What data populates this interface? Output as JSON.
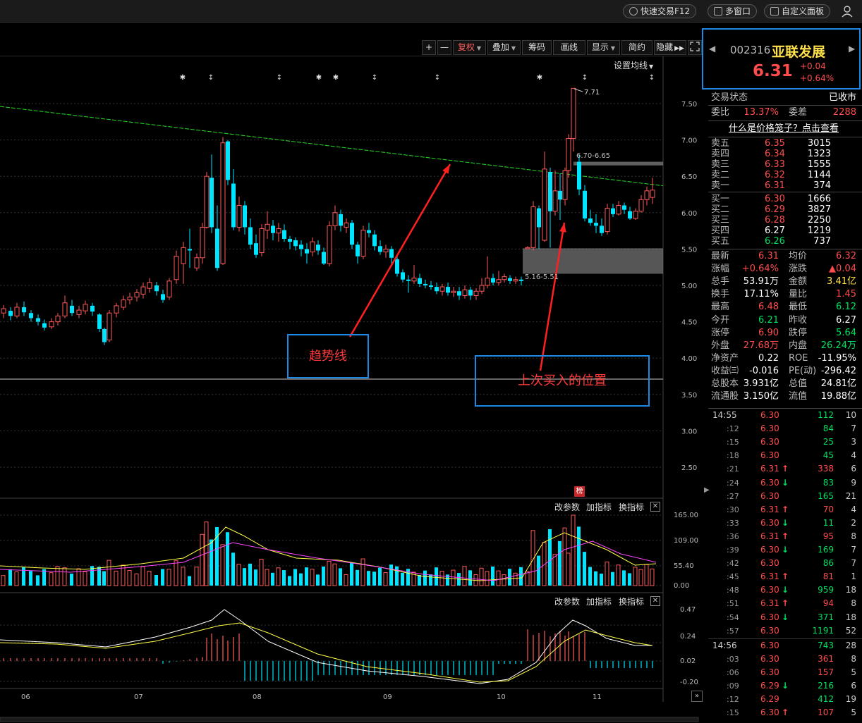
{
  "titlebar": {
    "quick_trade": "快速交易F12",
    "multi_window": "多窗口",
    "custom_panel": "自定义面板",
    "user_icon": "user-icon"
  },
  "toolbar": {
    "plus": "+",
    "minus": "—",
    "fuquan": "复权",
    "diejia": "叠加",
    "chouma": "筹码",
    "huaxian": "画线",
    "xianshi": "显示",
    "jianyue": "简约",
    "yincang": "隐藏",
    "expand_icon": "expand-icon"
  },
  "chart": {
    "setting_ma": "设置均线",
    "price_ticks": [
      "7.50",
      "7.00",
      "6.50",
      "6.00",
      "5.50",
      "5.00",
      "4.50",
      "4.00",
      "3.50",
      "3.00",
      "2.50"
    ],
    "vol_ticks": [
      "165.00",
      "109.00",
      "55.40",
      "0.00"
    ],
    "macd_ticks": [
      "0.47",
      "0.24",
      "0.02",
      "-0.20"
    ],
    "x_ticks": [
      "06",
      "07",
      "08",
      "09",
      "10",
      "11"
    ],
    "high_label": "7.71",
    "range_label_1": "6.70-6.65",
    "range_label_2": "5.16-5.51",
    "bang_badge": "榜",
    "sub1": {
      "change_param": "改参数",
      "add_indicator": "加指标",
      "switch_indicator": "换指标"
    },
    "sub2": {
      "change_param": "改参数",
      "add_indicator": "加指标",
      "switch_indicator": "换指标"
    },
    "annotation_trend": "趋势线",
    "annotation_buy": "上次买入的位置",
    "colors": {
      "up": "#ff5a5a",
      "down": "#00e5ff",
      "trend": "#22cc22",
      "ma_white": "#ffffff",
      "ma_yellow": "#ffff44",
      "ma_magenta": "#ff44ff",
      "arrow": "#ff2020"
    }
  },
  "quote": {
    "code": "002316",
    "name": "亚联发展",
    "price": "6.31",
    "change": "+0.04",
    "pct": "+0.64%"
  },
  "status": {
    "label": "交易状态",
    "value": "已收市"
  },
  "weibi": {
    "label": "委比",
    "value": "13.37%",
    "label2": "委差",
    "value2": "2288"
  },
  "cage_link": "什么是价格笼子？点击查看",
  "asks": [
    {
      "label": "卖五",
      "price": "6.35",
      "vol": "3015"
    },
    {
      "label": "卖四",
      "price": "6.34",
      "vol": "1323"
    },
    {
      "label": "卖三",
      "price": "6.33",
      "vol": "1555"
    },
    {
      "label": "卖二",
      "price": "6.32",
      "vol": "1144"
    },
    {
      "label": "卖一",
      "price": "6.31",
      "vol": "374"
    }
  ],
  "bids": [
    {
      "label": "买一",
      "price": "6.30",
      "vol": "1666"
    },
    {
      "label": "买二",
      "price": "6.29",
      "vol": "3827"
    },
    {
      "label": "买三",
      "price": "6.28",
      "vol": "2250"
    },
    {
      "label": "买四",
      "price": "6.27",
      "vol": "1219"
    },
    {
      "label": "买五",
      "price": "6.26",
      "vol": "737"
    }
  ],
  "stats": [
    {
      "l1": "最新",
      "v1": "6.31",
      "c1": "red",
      "l2": "均价",
      "v2": "6.32",
      "c2": "red"
    },
    {
      "l1": "涨幅",
      "v1": "+0.64%",
      "c1": "red",
      "l2": "涨跌",
      "v2": "▲0.04",
      "c2": "red"
    },
    {
      "l1": "总手",
      "v1": "53.91万",
      "c1": "white",
      "l2": "金额",
      "v2": "3.41亿",
      "c2": "yellow"
    },
    {
      "l1": "换手",
      "v1": "17.11%",
      "c1": "white",
      "l2": "量比",
      "v2": "1.45",
      "c2": "red"
    },
    {
      "l1": "最高",
      "v1": "6.48",
      "c1": "red",
      "l2": "最低",
      "v2": "6.12",
      "c2": "green"
    },
    {
      "l1": "今开",
      "v1": "6.21",
      "c1": "green",
      "l2": "昨收",
      "v2": "6.27",
      "c2": "white"
    },
    {
      "l1": "涨停",
      "v1": "6.90",
      "c1": "red",
      "l2": "跌停",
      "v2": "5.64",
      "c2": "green"
    },
    {
      "l1": "外盘",
      "v1": "27.68万",
      "c1": "red",
      "l2": "内盘",
      "v2": "26.24万",
      "c2": "green"
    },
    {
      "l1": "净资产",
      "v1": "0.22",
      "c1": "white",
      "l2": "ROE",
      "v2": "-11.95%",
      "c2": "white"
    },
    {
      "l1": "收益㈢",
      "v1": "-0.016",
      "c1": "white",
      "l2": "PE(动)",
      "v2": "-296.42",
      "c2": "white"
    },
    {
      "l1": "总股本",
      "v1": "3.931亿",
      "c1": "white",
      "l2": "总值",
      "v2": "24.81亿",
      "c2": "white"
    },
    {
      "l1": "流通股",
      "v1": "3.150亿",
      "c1": "white",
      "l2": "流值",
      "v2": "19.88亿",
      "c2": "white"
    }
  ],
  "ticks": [
    {
      "t": "14:55",
      "p": "6.30",
      "pc": "red",
      "a": "",
      "v": "112",
      "vc": "green",
      "c": "10"
    },
    {
      "t": ":12",
      "p": "6.30",
      "pc": "red",
      "a": "",
      "v": "84",
      "vc": "green",
      "c": "7"
    },
    {
      "t": ":15",
      "p": "6.30",
      "pc": "red",
      "a": "",
      "v": "25",
      "vc": "green",
      "c": "3"
    },
    {
      "t": ":18",
      "p": "6.30",
      "pc": "red",
      "a": "",
      "v": "45",
      "vc": "green",
      "c": "4"
    },
    {
      "t": ":21",
      "p": "6.31",
      "pc": "red",
      "a": "↑",
      "v": "338",
      "vc": "red",
      "c": "6"
    },
    {
      "t": ":24",
      "p": "6.30",
      "pc": "red",
      "a": "↓",
      "v": "83",
      "vc": "green",
      "c": "9"
    },
    {
      "t": ":27",
      "p": "6.30",
      "pc": "red",
      "a": "",
      "v": "165",
      "vc": "green",
      "c": "21"
    },
    {
      "t": ":30",
      "p": "6.31",
      "pc": "red",
      "a": "↑",
      "v": "70",
      "vc": "red",
      "c": "4"
    },
    {
      "t": ":33",
      "p": "6.30",
      "pc": "red",
      "a": "↓",
      "v": "11",
      "vc": "green",
      "c": "2"
    },
    {
      "t": ":36",
      "p": "6.31",
      "pc": "red",
      "a": "↑",
      "v": "95",
      "vc": "red",
      "c": "8"
    },
    {
      "t": ":39",
      "p": "6.30",
      "pc": "red",
      "a": "↓",
      "v": "169",
      "vc": "green",
      "c": "7"
    },
    {
      "t": ":42",
      "p": "6.30",
      "pc": "red",
      "a": "",
      "v": "86",
      "vc": "green",
      "c": "7"
    },
    {
      "t": ":45",
      "p": "6.31",
      "pc": "red",
      "a": "↑",
      "v": "81",
      "vc": "red",
      "c": "1"
    },
    {
      "t": ":48",
      "p": "6.30",
      "pc": "red",
      "a": "↓",
      "v": "959",
      "vc": "green",
      "c": "18"
    },
    {
      "t": ":51",
      "p": "6.31",
      "pc": "red",
      "a": "↑",
      "v": "94",
      "vc": "red",
      "c": "8"
    },
    {
      "t": ":54",
      "p": "6.30",
      "pc": "red",
      "a": "↓",
      "v": "371",
      "vc": "green",
      "c": "18"
    },
    {
      "t": ":57",
      "p": "6.30",
      "pc": "red",
      "a": "",
      "v": "1191",
      "vc": "green",
      "c": "52"
    },
    {
      "t": "14:56",
      "p": "6.30",
      "pc": "red",
      "a": "",
      "v": "743",
      "vc": "green",
      "c": "28"
    },
    {
      "t": ":03",
      "p": "6.30",
      "pc": "red",
      "a": "",
      "v": "361",
      "vc": "red",
      "c": "8"
    },
    {
      "t": ":06",
      "p": "6.30",
      "pc": "red",
      "a": "",
      "v": "157",
      "vc": "red",
      "c": "5"
    },
    {
      "t": ":09",
      "p": "6.29",
      "pc": "red",
      "a": "↓",
      "v": "216",
      "vc": "green",
      "c": "6"
    },
    {
      "t": ":12",
      "p": "6.29",
      "pc": "red",
      "a": "",
      "v": "412",
      "vc": "green",
      "c": "19"
    },
    {
      "t": ":15",
      "p": "6.30",
      "pc": "red",
      "a": "↑",
      "v": "107",
      "vc": "red",
      "c": "5"
    }
  ]
}
